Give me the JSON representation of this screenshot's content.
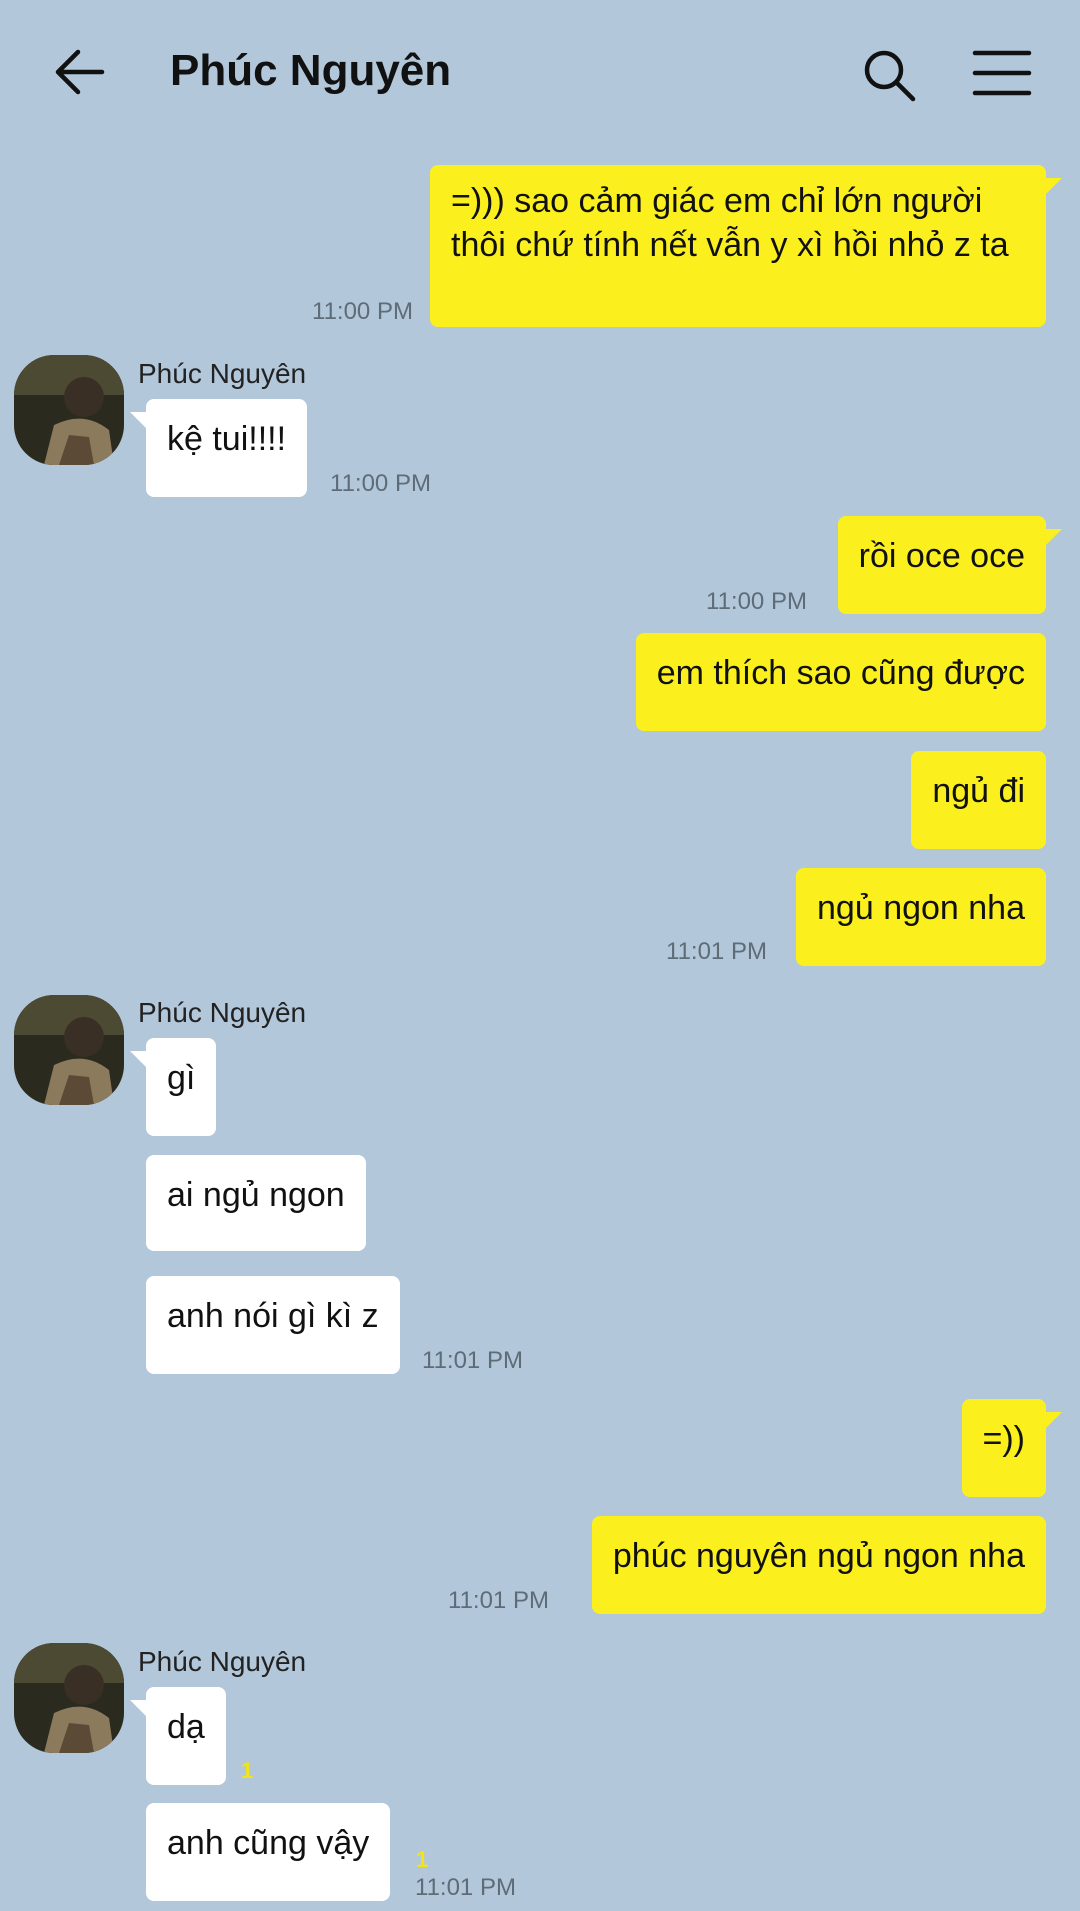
{
  "header": {
    "title": "Phúc Nguyên",
    "back_icon": "arrow-left-icon",
    "search_icon": "search-icon",
    "menu_icon": "hamburger-menu-icon"
  },
  "colors": {
    "background": "#b2c7da",
    "outgoing_bubble": "#fbf01d",
    "incoming_bubble": "#ffffff",
    "unread_count": "#f3e414"
  },
  "contact": {
    "name": "Phúc Nguyên"
  },
  "messages": [
    {
      "dir": "out",
      "text": "=))) sao cảm giác em chỉ lớn người thôi chứ tính nết vẫn y xì hồi nhỏ z ta",
      "time": "11:00 PM"
    },
    {
      "dir": "in",
      "sender": "Phúc Nguyên",
      "text": "kệ tui!!!!",
      "time": "11:00 PM"
    },
    {
      "dir": "out",
      "text": "rồi oce oce",
      "time": "11:00 PM"
    },
    {
      "dir": "out",
      "text": "em thích sao cũng được"
    },
    {
      "dir": "out",
      "text": "ngủ đi"
    },
    {
      "dir": "out",
      "text": "ngủ ngon nha",
      "time": "11:01 PM"
    },
    {
      "dir": "in",
      "sender": "Phúc Nguyên",
      "text": "gì"
    },
    {
      "dir": "in",
      "text": "ai ngủ ngon"
    },
    {
      "dir": "in",
      "text": "anh nói gì kì z",
      "time": "11:01 PM"
    },
    {
      "dir": "out",
      "text": "=))"
    },
    {
      "dir": "out",
      "text": "phúc nguyên ngủ ngon nha",
      "time": "11:01 PM"
    },
    {
      "dir": "in",
      "sender": "Phúc Nguyên",
      "text": "dạ",
      "unread": "1"
    },
    {
      "dir": "in",
      "text": "anh cũng vậy",
      "unread": "1",
      "time": "11:01 PM"
    }
  ]
}
